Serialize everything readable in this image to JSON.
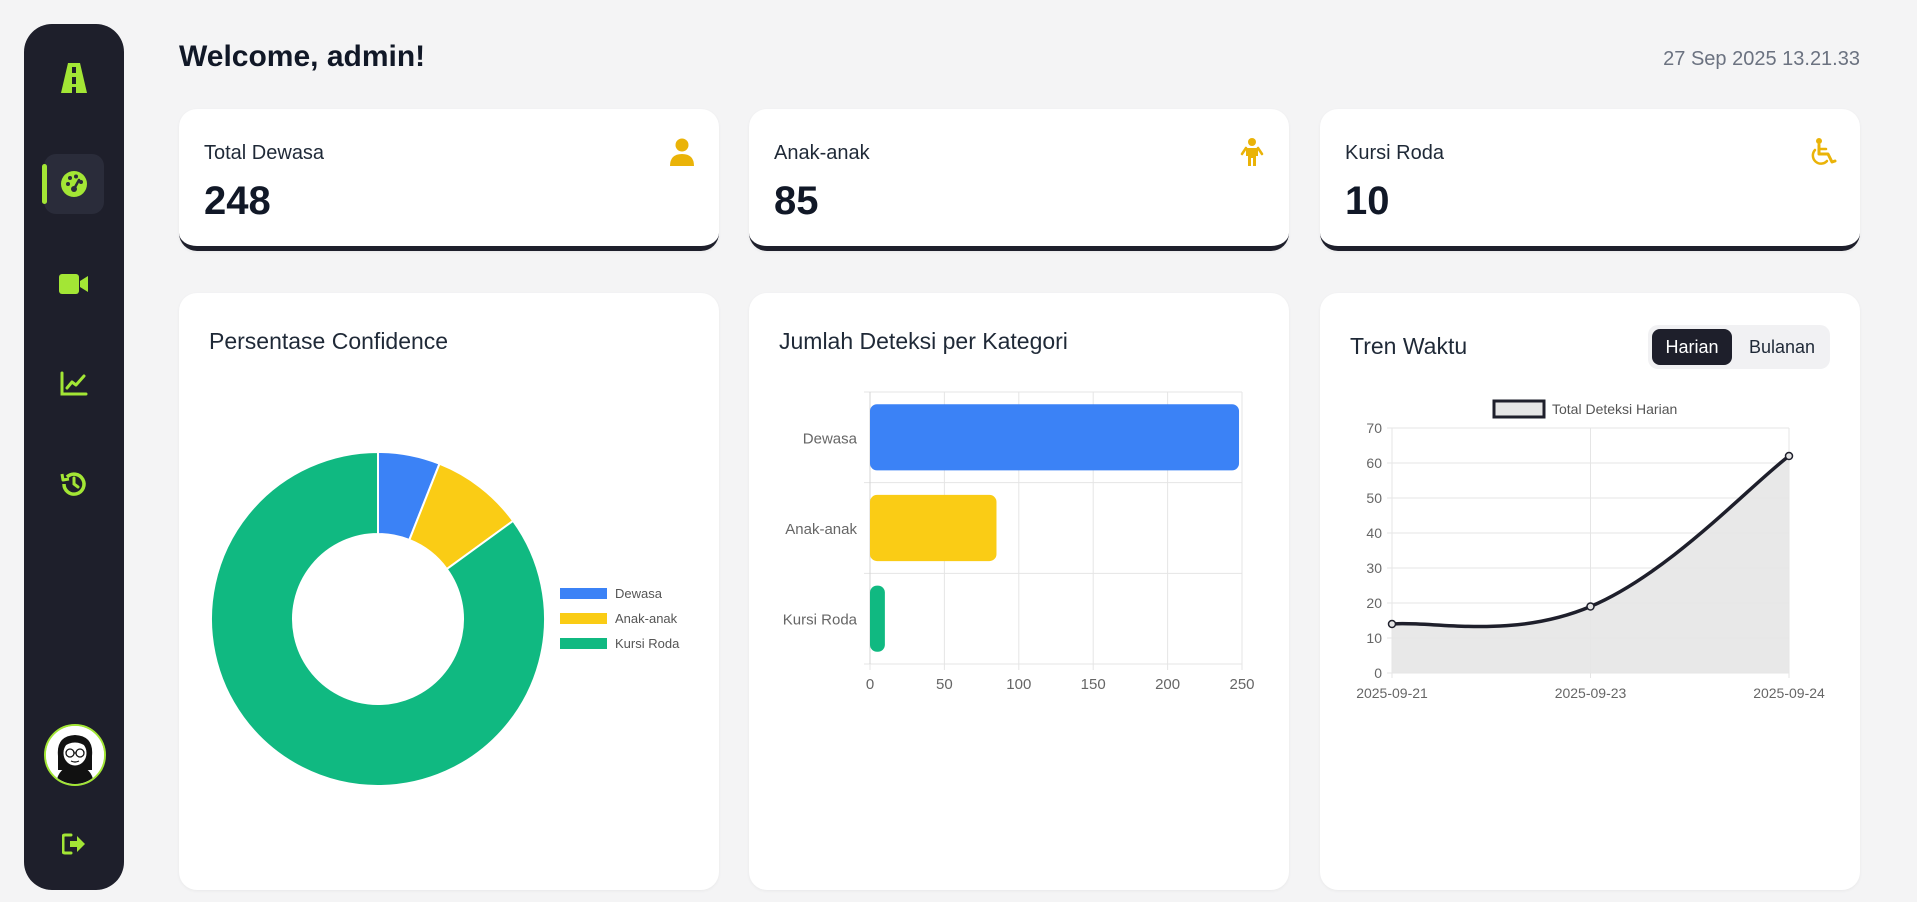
{
  "header": {
    "welcome": "Welcome, admin!",
    "datetime": "27 Sep 2025 13.21.33"
  },
  "sidebar": {
    "items": [
      {
        "icon": "logo-icon"
      },
      {
        "icon": "dashboard-icon",
        "active": true
      },
      {
        "icon": "video-camera-icon"
      },
      {
        "icon": "chart-line-icon"
      },
      {
        "icon": "history-icon"
      }
    ],
    "bottom": [
      {
        "icon": "avatar"
      },
      {
        "icon": "logout-icon"
      }
    ],
    "accent": "#a3e635"
  },
  "stats": [
    {
      "label": "Total Dewasa",
      "value": "248",
      "icon": "user-icon"
    },
    {
      "label": "Anak-anak",
      "value": "85",
      "icon": "child-icon"
    },
    {
      "label": "Kursi Roda",
      "value": "10",
      "icon": "wheelchair-icon"
    }
  ],
  "cards": {
    "confidence": {
      "title": "Persentase Confidence"
    },
    "category": {
      "title": "Jumlah Deteksi per Kategori"
    },
    "trend": {
      "title": "Tren Waktu",
      "toggle": {
        "active": "Harian",
        "inactive": "Bulanan"
      }
    }
  },
  "chart_data": [
    {
      "type": "pie",
      "variant": "doughnut",
      "labels": [
        "Dewasa",
        "Anak-anak",
        "Kursi Roda"
      ],
      "values": [
        6,
        9,
        85
      ],
      "colors": [
        "#3b82f6",
        "#facc15",
        "#10b981"
      ],
      "legend": "right"
    },
    {
      "type": "bar",
      "orientation": "horizontal",
      "categories": [
        "Dewasa",
        "Anak-anak",
        "Kursi Roda"
      ],
      "values": [
        248,
        85,
        10
      ],
      "colors": [
        "#3b82f6",
        "#facc15",
        "#10b981"
      ],
      "xlim": [
        0,
        250
      ],
      "xticks": [
        "0",
        "50",
        "100",
        "150",
        "200",
        "250"
      ],
      "grid": true
    },
    {
      "type": "area",
      "x": [
        "2025-09-21",
        "2025-09-23",
        "2025-09-24"
      ],
      "series": [
        {
          "name": "Total Deteksi Harian",
          "values": [
            14,
            19,
            62
          ]
        }
      ],
      "ylim": [
        0,
        70
      ],
      "yticks": [
        "0",
        "10",
        "20",
        "30",
        "40",
        "50",
        "60",
        "70"
      ],
      "line_color": "#1e1f2b",
      "fill_color": "#e5e5e5",
      "legend": "top",
      "grid": true
    }
  ]
}
